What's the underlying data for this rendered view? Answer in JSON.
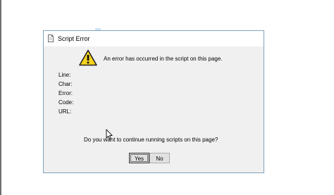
{
  "dialog": {
    "title": "Script Error",
    "message": "An error has occurred in the script on this page.",
    "fields": [
      {
        "label": "Line:"
      },
      {
        "label": "Char:"
      },
      {
        "label": "Error:"
      },
      {
        "label": "Code:"
      },
      {
        "label": "URL:"
      }
    ],
    "question": "Do you want to continue running scripts on this page?",
    "buttons": {
      "yes_label": "Yes",
      "no_label": "No"
    },
    "icons": {
      "title_icon": "document-icon",
      "warning_icon": "warning-icon",
      "cursor": "mouse-cursor-icon"
    },
    "colors": {
      "dialog_background": "#f0f0f0",
      "titlebar_background": "#ffffff",
      "dialog_border": "#7fa2b8",
      "warning_yellow": "#f7d31c",
      "button_background": "#e1e1e1"
    }
  }
}
